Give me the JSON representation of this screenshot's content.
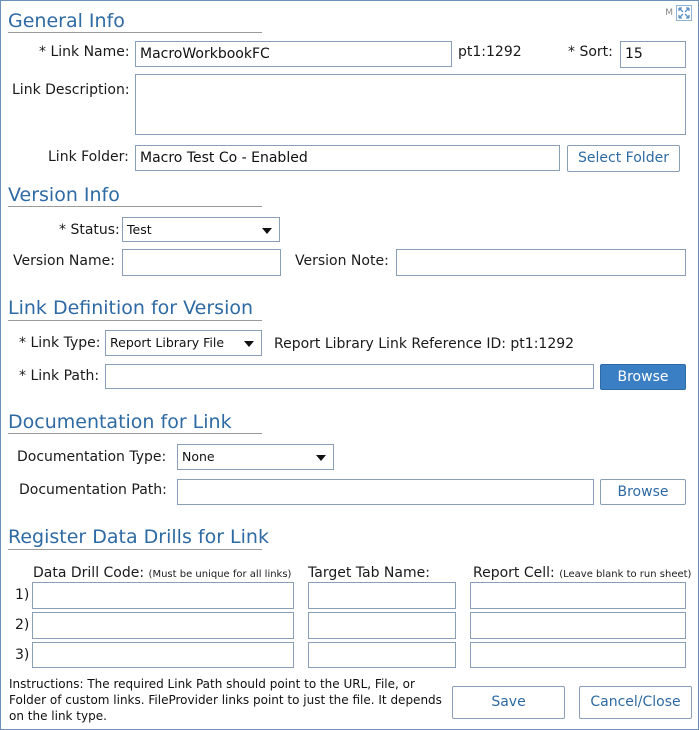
{
  "corner": {
    "mode_letter": "M"
  },
  "general_info": {
    "title": "General Info",
    "link_name_label": "* Link Name:",
    "link_name_value": "MacroWorkbookFC",
    "ref_id": "pt1:1292",
    "sort_label": "* Sort:",
    "sort_value": "15",
    "description_label": "Link Description:",
    "description_value": "",
    "folder_label": "Link Folder:",
    "folder_value": "Macro Test Co - Enabled",
    "select_folder_button": "Select Folder"
  },
  "version_info": {
    "title": "Version Info",
    "status_label": "* Status:",
    "status_value": "Test",
    "version_name_label": "Version Name:",
    "version_name_value": "",
    "version_note_label": "Version Note:",
    "version_note_value": ""
  },
  "link_definition": {
    "title": "Link Definition for Version",
    "link_type_label": "* Link Type:",
    "link_type_value": "Report Library File",
    "reference_text": "Report Library Link Reference ID: pt1:1292",
    "link_path_label": "* Link Path:",
    "link_path_value": "",
    "browse_button": "Browse"
  },
  "documentation": {
    "title": "Documentation for Link",
    "type_label": "Documentation Type:",
    "type_value": "None",
    "path_label": "Documentation Path:",
    "path_value": "",
    "browse_button": "Browse"
  },
  "data_drills": {
    "title": "Register Data Drills for Link",
    "col_code": "Data Drill Code:",
    "col_code_note": "(Must be unique for all links)",
    "col_tab": "Target Tab Name:",
    "col_cell": "Report Cell:",
    "col_cell_note": "(Leave blank to run sheet)",
    "rows": [
      {
        "num": "1)",
        "code": "",
        "tab": "",
        "cell": ""
      },
      {
        "num": "2)",
        "code": "",
        "tab": "",
        "cell": ""
      },
      {
        "num": "3)",
        "code": "",
        "tab": "",
        "cell": ""
      }
    ]
  },
  "footer": {
    "instructions": "Instructions: The required Link Path should point to the URL, File, or Folder of custom links. FileProvider links point to just the file. It depends on the link type.",
    "save_button": "Save",
    "cancel_button": "Cancel/Close"
  }
}
